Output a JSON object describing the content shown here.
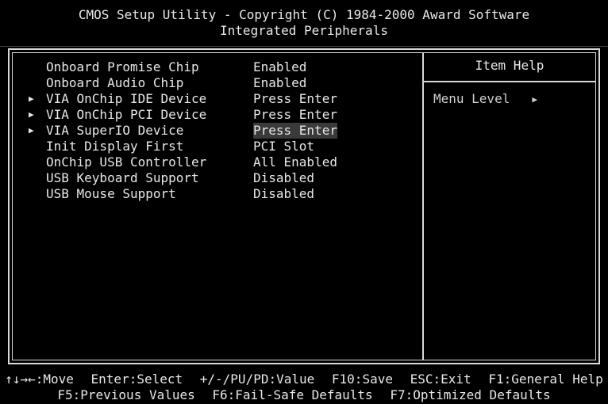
{
  "header": {
    "title": "CMOS Setup Utility - Copyright (C) 1984-2000 Award Software",
    "subtitle": "Integrated Peripherals"
  },
  "settings": [
    {
      "marker": "",
      "label": "Onboard Promise Chip",
      "value": "Enabled"
    },
    {
      "marker": "",
      "label": "Onboard Audio Chip",
      "value": "Enabled"
    },
    {
      "marker": "▶",
      "label": "VIA OnChip IDE Device",
      "value": "Press Enter"
    },
    {
      "marker": "▶",
      "label": "VIA OnChip PCI Device",
      "value": "Press Enter"
    },
    {
      "marker": "▶",
      "label": "VIA SuperIO Device",
      "value": "Press Enter"
    },
    {
      "marker": "",
      "label": "Init Display First",
      "value": "PCI Slot"
    },
    {
      "marker": "",
      "label": "OnChip USB Controller",
      "value": "All Enabled"
    },
    {
      "marker": "",
      "label": "USB Keyboard Support",
      "value": "Disabled"
    },
    {
      "marker": "",
      "label": "USB Mouse Support",
      "value": "Disabled"
    }
  ],
  "help": {
    "title": "Item Help",
    "menu_level_label": "Menu Level",
    "menu_level_arrow": "▶"
  },
  "footer": {
    "line1": [
      "↑↓→←:Move",
      "Enter:Select",
      "+/-/PU/PD:Value",
      "F10:Save",
      "ESC:Exit",
      "F1:General Help"
    ],
    "line2": [
      "F5:Previous Values",
      "F6:Fail-Safe Defaults",
      "F7:Optimized Defaults"
    ]
  },
  "colors": {
    "background": "#000000",
    "text": "#e8e8e8",
    "border": "#d8d8d8",
    "selection": "#3a3a3a"
  }
}
